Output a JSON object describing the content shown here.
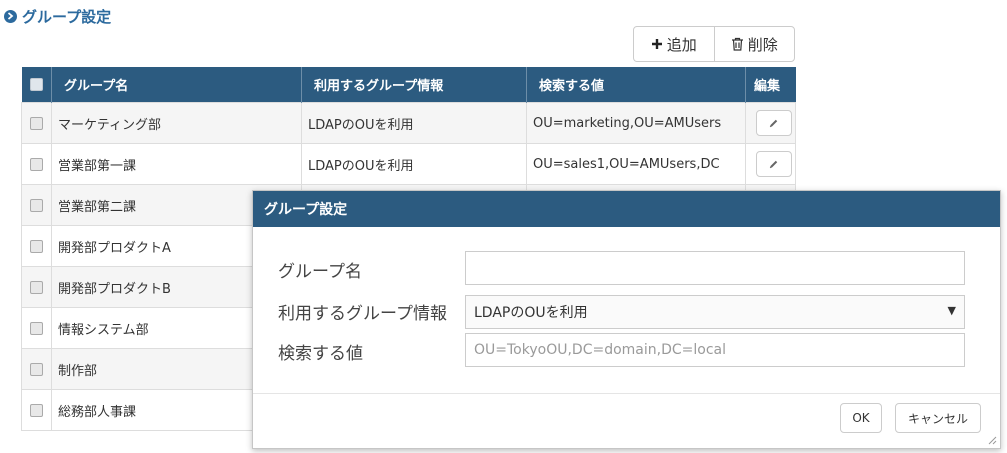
{
  "page": {
    "title": "グループ設定"
  },
  "toolbar": {
    "add_label": "追加",
    "delete_label": "削除"
  },
  "table": {
    "headers": {
      "name": "グループ名",
      "info": "利用するグループ情報",
      "value": "検索する値",
      "edit": "編集"
    },
    "rows": [
      {
        "name": "マーケティング部",
        "info": "LDAPのOUを利用",
        "value": "OU=marketing,OU=AMUsers"
      },
      {
        "name": "営業部第一課",
        "info": "LDAPのOUを利用",
        "value": "OU=sales1,OU=AMUsers,DC"
      },
      {
        "name": "営業部第二課",
        "info": "",
        "value": ""
      },
      {
        "name": "開発部プロダクトA",
        "info": "",
        "value": ""
      },
      {
        "name": "開発部プロダクトB",
        "info": "",
        "value": ""
      },
      {
        "name": "情報システム部",
        "info": "",
        "value": ""
      },
      {
        "name": "制作部",
        "info": "",
        "value": ""
      },
      {
        "name": "総務部人事課",
        "info": "",
        "value": ""
      }
    ]
  },
  "modal": {
    "title": "グループ設定",
    "fields": {
      "name_label": "グループ名",
      "name_value": "",
      "info_label": "利用するグループ情報",
      "info_selected": "LDAPのOUを利用",
      "value_label": "検索する値",
      "value_placeholder": "OU=TokyoOU,DC=domain,DC=local"
    },
    "ok_label": "OK",
    "cancel_label": "キャンセル"
  },
  "colors": {
    "accent": "#2c6a9e",
    "header_bg": "#2c5b80"
  },
  "icons": {
    "title": "chevron-right-circle-icon",
    "add": "plus-icon",
    "delete": "trash-icon",
    "edit": "pencil-icon"
  }
}
